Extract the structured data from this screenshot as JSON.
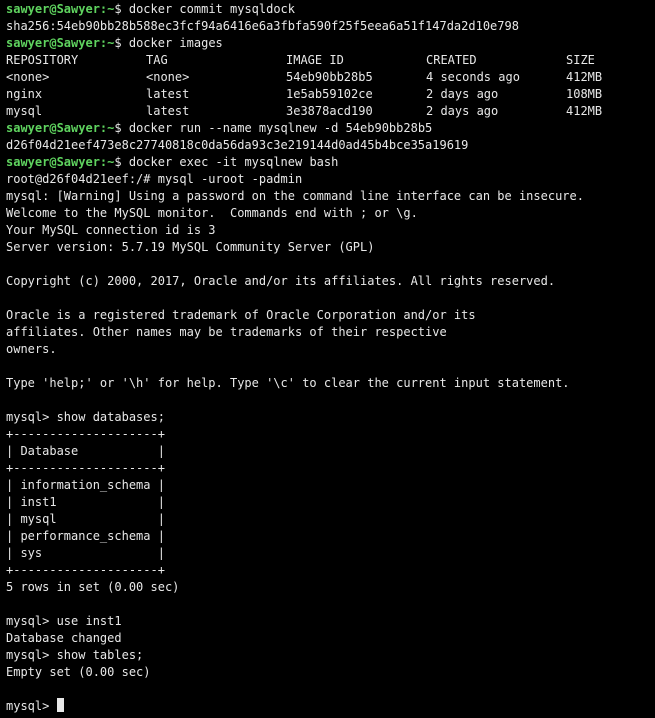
{
  "prompt": {
    "user_host": "sawyer@Sawyer",
    "sep": ":",
    "cwd": "~",
    "symbol": "$ "
  },
  "block1": {
    "cmd": "docker commit mysqldock",
    "output": "sha256:54eb90bb28b588ec3fcf94a6416e6a3fbfa590f25f5eea6a51f147da2d10e798"
  },
  "block2": {
    "cmd": "docker images",
    "headers": [
      "REPOSITORY",
      "TAG",
      "IMAGE ID",
      "CREATED",
      "SIZE"
    ],
    "rows": [
      [
        "<none>",
        "<none>",
        "54eb90bb28b5",
        "4 seconds ago",
        "412MB"
      ],
      [
        "nginx",
        "latest",
        "1e5ab59102ce",
        "2 days ago",
        "108MB"
      ],
      [
        "mysql",
        "latest",
        "3e3878acd190",
        "2 days ago",
        "412MB"
      ]
    ]
  },
  "block3": {
    "cmd": "docker run --name mysqlnew -d 54eb90bb28b5",
    "output": "d26f04d21eef473e8c27740818c0da56da93c3e219144d0ad45b4bce35a19619"
  },
  "block4": {
    "cmd": "docker exec -it mysqlnew bash",
    "root_prompt": "root@d26f04d21eef:/# mysql -uroot -padmin",
    "lines": [
      "mysql: [Warning] Using a password on the command line interface can be insecure.",
      "Welcome to the MySQL monitor.  Commands end with ; or \\g.",
      "Your MySQL connection id is 3",
      "Server version: 5.7.19 MySQL Community Server (GPL)",
      "",
      "Copyright (c) 2000, 2017, Oracle and/or its affiliates. All rights reserved.",
      "",
      "Oracle is a registered trademark of Oracle Corporation and/or its",
      "affiliates. Other names may be trademarks of their respective",
      "owners.",
      "",
      "Type 'help;' or '\\h' for help. Type '\\c' to clear the current input statement.",
      "",
      "mysql> show databases;",
      "+--------------------+",
      "| Database           |",
      "+--------------------+",
      "| information_schema |",
      "| inst1              |",
      "| mysql              |",
      "| performance_schema |",
      "| sys                |",
      "+--------------------+",
      "5 rows in set (0.00 sec)",
      "",
      "mysql> use inst1",
      "Database changed",
      "mysql> show tables;",
      "Empty set (0.00 sec)",
      ""
    ],
    "final_prompt": "mysql> "
  },
  "colors": {
    "background": "#000000",
    "text": "#e8e8e8",
    "prompt": "#5fd35f"
  }
}
